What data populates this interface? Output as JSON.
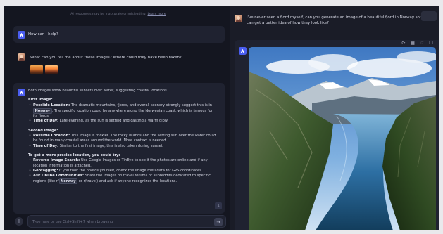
{
  "disclaimer": {
    "text": "AI responses may be inaccurate or misleading.",
    "link": "Learn more"
  },
  "chat": {
    "greeting": "How can I help?",
    "user_question": "What can you tell me about these images? Where could they have been taken?",
    "response": {
      "intro": "Both images show beautiful sunsets over water, suggesting coastal locations.",
      "first_heading": "First image:",
      "first_items": [
        {
          "label": "Possible Location:",
          "text_before": "The dramatic mountains, fjords, and overall scenery strongly suggest this is in",
          "tag": "Norway",
          "text_after": ". The specific location could be anywhere along the Norwegian coast, which is famous for its fjords."
        },
        {
          "label": "Time of Day:",
          "text": "Late evening, as the sun is setting and casting a warm glow."
        }
      ],
      "second_heading": "Second image:",
      "second_items": [
        {
          "label": "Possible Location:",
          "text": "This image is trickier. The rocky islands and the setting sun over the water could be found in many coastal areas around the world. More context is needed."
        },
        {
          "label": "Time of Day:",
          "text": "Similar to the first image, this is also taken during sunset."
        }
      ],
      "precise_heading": "To get a more precise location, you could try:",
      "precise_items": [
        {
          "label": "Reverse Image Search:",
          "text": "Use Google Images or TinEye to see if the photos are online and if any location information is attached."
        },
        {
          "label": "Geotagging:",
          "text": "If you took the photos yourself, check the image metadata for GPS coordinates."
        },
        {
          "label": "Ask Online Communities:",
          "text_before": "Share the images on travel forums or subreddits dedicated to specific regions (like r/",
          "tag": "Norway",
          "text_after": " or r/travel) and ask if anyone recognizes the locations."
        }
      ]
    }
  },
  "input": {
    "placeholder": "Type here or use Ctrl+Shift+7 when browsing",
    "plus_symbol": "+",
    "send_symbol": "→"
  },
  "right_panel": {
    "user_question": "I've never seen a fjord myself, can you generate an image of a beautiful fjord in Norway so that I can get a better idea of how they look like?",
    "toolbar_icons": [
      "refresh-icon",
      "grid-icon",
      "thumb-icon",
      "copy-icon"
    ]
  },
  "colors": {
    "background": "#141620",
    "bubble": "#1f2230",
    "accent": "#4a5df0"
  }
}
